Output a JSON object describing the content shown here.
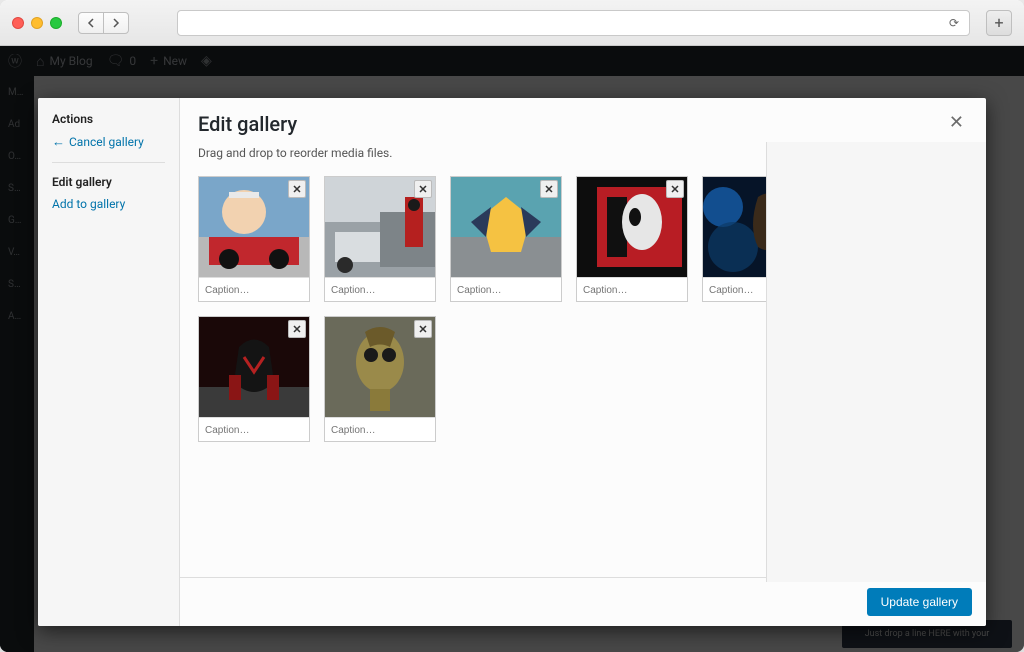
{
  "browser": {
    "traffic": {
      "red": "#ff5f57",
      "yellow": "#ffbd2e",
      "green": "#28c940"
    }
  },
  "admin_bar": {
    "site_name": "My Blog",
    "comments": "0",
    "new_label": "New"
  },
  "bg_box_text": "Just drop a line HERE with your",
  "modal": {
    "sidebar": {
      "actions_heading": "Actions",
      "cancel": "Cancel gallery",
      "edit_heading": "Edit gallery",
      "add_link": "Add to gallery"
    },
    "title": "Edit gallery",
    "hint": "Drag and drop to reorder media files.",
    "update_button": "Update gallery",
    "caption_placeholder": "Caption…",
    "items": [
      {
        "id": "img1"
      },
      {
        "id": "img2"
      },
      {
        "id": "img3"
      },
      {
        "id": "img4"
      },
      {
        "id": "img5"
      },
      {
        "id": "img6"
      },
      {
        "id": "img7"
      },
      {
        "id": "img8"
      }
    ]
  }
}
